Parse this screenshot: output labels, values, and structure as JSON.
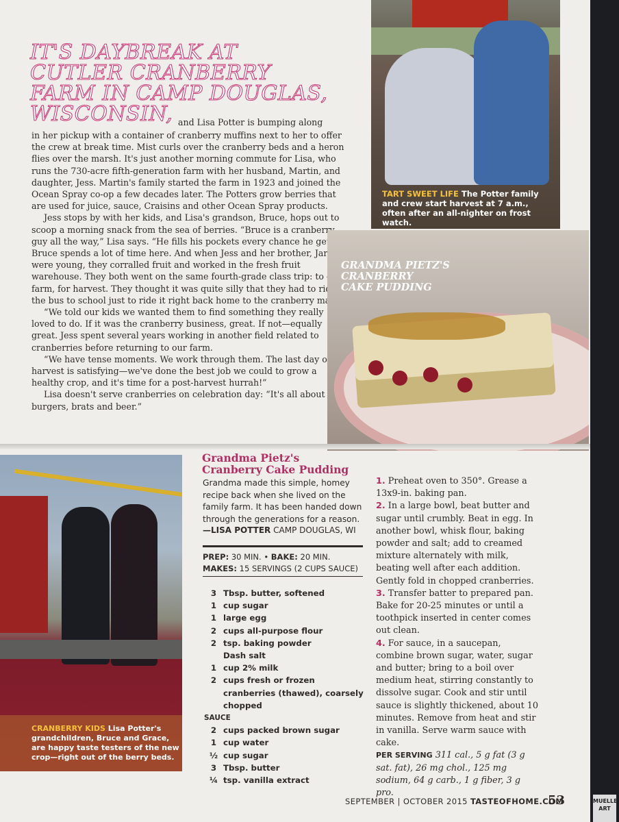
{
  "headline": {
    "lines": [
      "It's daybreak at",
      "Cutler Cranberry",
      "Farm in Camp Douglas,",
      "Wisconsin,"
    ]
  },
  "story": {
    "lead_in": "and Lisa Potter is bumping along",
    "paragraphs": [
      "in her pickup with a container of cranberry muffins next to her to offer the crew at break time. Mist curls over the cranberry beds and a heron flies over the marsh. It's just another morning commute for Lisa, who runs the 730-acre fifth-generation farm with her husband, Martin, and daughter, Jess. Martin's family started the farm in 1923 and joined the Ocean Spray co-op a few decades later. The Potters grow berries that are used for juice, sauce, Craisins and other Ocean Spray products.",
      "Jess stops by with her kids, and Lisa's grandson, Bruce, hops out to scoop a morning snack from the sea of berries. “Bruce is a cranberry guy all the way,” Lisa says. “He fills his pockets every chance he gets. Bruce spends a lot of time here. And when Jess and her brother, Jared, were young, they corralled fruit and worked in the fresh fruit warehouse. They both went on the same fourth-grade class trip: to our farm, for harvest. They thought it was quite silly that they had to ride the bus to school just to ride it right back home to the cranberry marsh.",
      "“We told our kids we wanted them to find something they really loved to do. If it was the cranberry business, great. If not—equally great. Jess spent several years working in another field related to cranberries before returning to our farm.",
      "“We have tense moments. We work through them. The last day of harvest is satisfying—we've done the best job we could to grow a healthy crop, and it's time for a post-harvest hurrah!”",
      "Lisa doesn't serve cranberries on celebration day: “It's all about the burgers, brats and beer.”"
    ]
  },
  "photo_farm": {
    "caption_tag": "TART SWEET LIFE",
    "caption_text": " The Potter family and crew start harvest at 7 a.m., often after an all-nighter on frost watch."
  },
  "photo_cake": {
    "overlay_lines": [
      "Grandma Pietz's",
      "Cranberry",
      "Cake Pudding"
    ]
  },
  "photo_kids": {
    "caption_tag": "CRANBERRY KIDS",
    "caption_text": " Lisa Potter's grandchildren, Bruce and Grace, are happy taste testers of the new crop—right out of the berry beds."
  },
  "recipe": {
    "title_lines": [
      "Grandma Pietz's",
      "Cranberry Cake Pudding"
    ],
    "intro": "Grandma made this simple, homey recipe back when she lived on the family farm. It has been handed down through the generations for a reason.",
    "credit_name": "—LISA POTTER",
    "credit_place": " CAMP DOUGLAS, WI",
    "prep_label": "PREP:",
    "prep_value": " 30 MIN. • ",
    "bake_label": "BAKE:",
    "bake_value": " 20 MIN.",
    "makes_label": "MAKES:",
    "makes_value": " 15 SERVINGS (2 CUPS SAUCE)",
    "ingredients": [
      {
        "q": "3",
        "t": "Tbsp. butter, softened"
      },
      {
        "q": "1",
        "t": "cup sugar"
      },
      {
        "q": "1",
        "t": "large egg"
      },
      {
        "q": "2",
        "t": "cups all-purpose flour"
      },
      {
        "q": "2",
        "t": "tsp. baking powder"
      },
      {
        "q": "",
        "t": "Dash salt"
      },
      {
        "q": "1",
        "t": "cup 2% milk"
      },
      {
        "q": "2",
        "t": "cups fresh or frozen cranberries (thawed), coarsely chopped"
      }
    ],
    "sauce_label": "SAUCE",
    "sauce_ingredients": [
      {
        "q": "2",
        "t": "cups packed brown sugar"
      },
      {
        "q": "1",
        "t": "cup water"
      },
      {
        "q": "½",
        "t": "cup sugar"
      },
      {
        "q": "3",
        "t": "Tbsp. butter"
      },
      {
        "q": "¼",
        "t": "tsp. vanilla extract"
      }
    ],
    "steps": [
      {
        "n": "1.",
        "t": "Preheat oven to 350°. Grease a 13x9-in. baking pan."
      },
      {
        "n": "2.",
        "t": "In a large bowl, beat butter and sugar until crumbly. Beat in egg. In another bowl, whisk flour, baking powder and salt; add to creamed mixture alternately with milk, beating well after each addition. Gently fold in chopped cranberries."
      },
      {
        "n": "3.",
        "t": "Transfer batter to prepared pan. Bake for 20-25 minutes or until a toothpick inserted in center comes out clean."
      },
      {
        "n": "4.",
        "t": "For sauce, in a saucepan, combine brown sugar, water, sugar and butter; bring to a boil over medium heat, stirring constantly to dissolve sugar. Cook and stir until sauce is slightly thickened, about 10 minutes. Remove from heat and stir in vanilla. Serve warm sauce with cake."
      }
    ],
    "nutrition_label": "PER SERVING",
    "nutrition_text": " 311 cal., 5 g fat (3 g sat. fat), 26 mg chol., 125 mg sodium, 64 g carb., 1 g fiber, 3 g pro."
  },
  "footer": {
    "issue": "SEPTEMBER | OCTOBER 2015",
    "site": "TASTEOFHOME.COM",
    "page_number": "53"
  },
  "stamp_text": "MUELLE ART",
  "colors": {
    "accent_pink": "#b03064",
    "caption_yellow": "#f6c13a"
  }
}
